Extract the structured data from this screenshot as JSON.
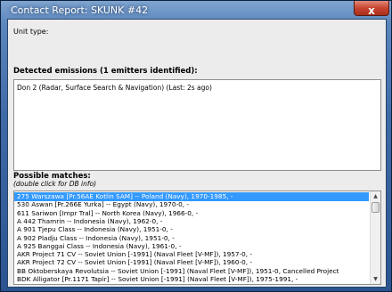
{
  "window": {
    "title": "Contact Report: SKUNK #42",
    "close_glyph": "x"
  },
  "unit_type": {
    "label": "Unit type:"
  },
  "emissions": {
    "heading": "Detected emissions (1 emitters identified):",
    "items": [
      "Don 2 (Radar, Surface Search & Navigation) (Last: 2s ago)"
    ]
  },
  "matches": {
    "heading": "Possible matches:",
    "hint": "(double click for DB info)",
    "selected_index": 0,
    "items": [
      "275 Warszawa [Pr.56AE Kotlin SAM] -- Poland (Navy), 1970-1985, -",
      "530 Aswan [Pr.266E Yurka] -- Egypt (Navy), 1970-0, -",
      "611 Sariwon [Impr Tral] -- North Korea (Navy), 1966-0, -",
      "A 442 Thamrin -- Indonesia (Navy), 1962-0, -",
      "A 901 Tjepu Class -- Indonesia (Navy), 1951-0, -",
      "A 902 Pladju Class -- Indonesia (Navy), 1951-0, -",
      "A 925 Banggai Class -- Indonesia (Navy), 1961-0, -",
      "AKR Project 71 CV -- Soviet Union [-1991] (Naval Fleet [V-MF]), 1957-0, -",
      "AKR Project 72 CV -- Soviet Union [-1991] (Naval Fleet [V-MF]), 1960-0, -",
      "BB Oktoberskaya Revolutsia -- Soviet Union [-1991] (Naval Fleet [V-MF]), 1951-0, Cancelled Project",
      "BDK Alligator [Pr.1171 Tapir] -- Soviet Union [-1991] (Naval Fleet [V-MF]), 1975-1991, -"
    ]
  }
}
